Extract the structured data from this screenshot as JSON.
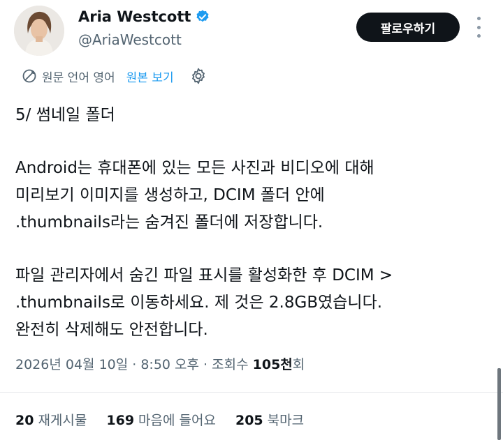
{
  "author": {
    "display_name": "Aria Westcott",
    "handle": "@AriaWestcott",
    "verified": true
  },
  "follow_button_label": "팔로우하기",
  "translation": {
    "source_language_label": "원문 언어 영어",
    "view_original_label": "원본 보기"
  },
  "post": {
    "heading": "5/ 썸네일 폴더",
    "paragraph1": [
      "Android는 휴대폰에 있는 모든 사진과 비디오에 대해",
      "미리보기 이미지를 생성하고, DCIM 폴더 안에",
      ".thumbnails라는 숨겨진 폴더에 저장합니다."
    ],
    "paragraph2": [
      "파일 관리자에서 숨긴 파일 표시를 활성화한 후 DCIM >",
      ".thumbnails로 이동하세요. 제 것은 2.8GB였습니다.",
      "완전히 삭제해도 안전합니다."
    ]
  },
  "meta": {
    "timestamp": "2026년 04월 10일 · 8:50 오후 · 조회수 ",
    "views_value": "105천",
    "views_suffix": "회"
  },
  "stats": {
    "reposts_count": "20",
    "reposts_label": "재게시물",
    "likes_count": "169",
    "likes_label": "마음에 들어요",
    "bookmarks_count": "205",
    "bookmarks_label": "북마크"
  },
  "colors": {
    "link": "#1d9bf0",
    "verified_badge": "#1d9bf0",
    "follow_button_bg": "#0f1419",
    "secondary_text": "#536471"
  },
  "icons": {
    "verified": "verified-badge-icon",
    "translate": "translate-icon",
    "settings": "gear-icon",
    "more": "more-vertical-icon"
  }
}
